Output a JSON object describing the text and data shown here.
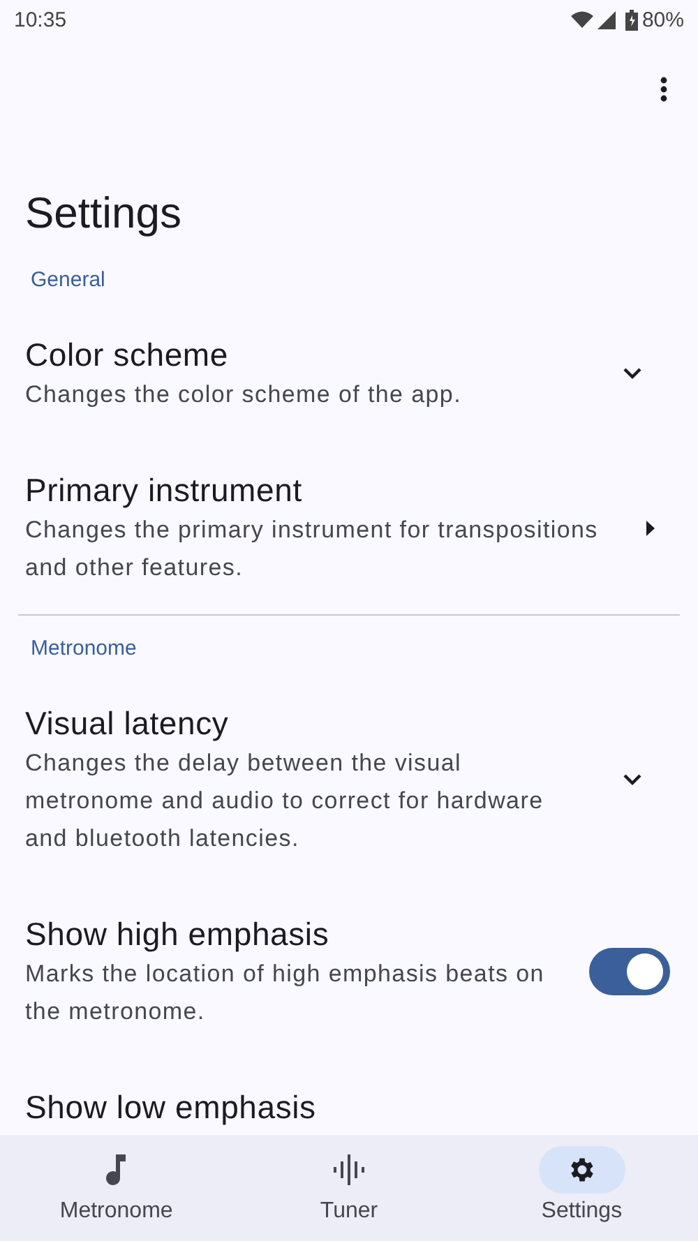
{
  "status_bar": {
    "time": "10:35",
    "battery": "80%"
  },
  "title": "Settings",
  "sections": [
    {
      "header": "General",
      "items": [
        {
          "kind": "dropdown",
          "title": "Color scheme",
          "description": "Changes the color scheme of the app."
        },
        {
          "kind": "submenu",
          "title": "Primary instrument",
          "description": "Changes the primary instrument for transpositions and other features."
        }
      ]
    },
    {
      "header": "Metronome",
      "items": [
        {
          "kind": "dropdown",
          "title": "Visual latency",
          "description": "Changes the delay between the visual metronome and audio to correct for hardware and bluetooth latencies."
        },
        {
          "kind": "switch",
          "title": "Show high emphasis",
          "description": "Marks the location of high emphasis beats on the metronome.",
          "on": true
        },
        {
          "kind": "plain",
          "title": "Show low emphasis"
        }
      ]
    }
  ],
  "nav": [
    {
      "label": "Metronome",
      "selected": false
    },
    {
      "label": "Tuner",
      "selected": false
    },
    {
      "label": "Settings",
      "selected": true
    }
  ]
}
